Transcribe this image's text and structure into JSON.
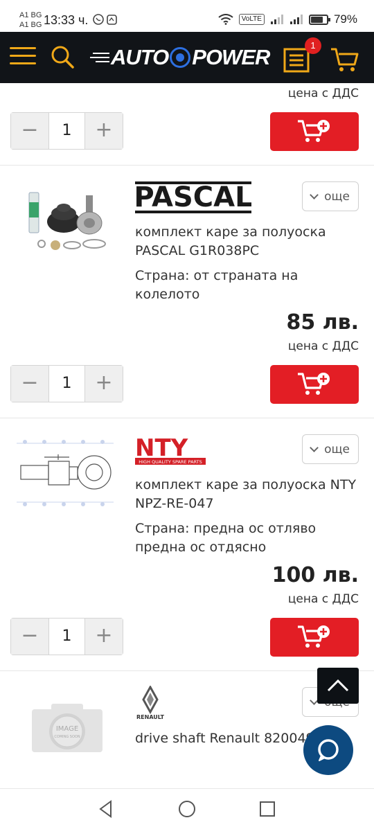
{
  "status_bar": {
    "carrier_1": "A1 BG",
    "carrier_2": "A1 BG",
    "time": "13:33 ч.",
    "volte": "VoLTE",
    "battery": "79%",
    "battery_level": 0.79
  },
  "header": {
    "logo_left": "AUTO",
    "logo_right": "POWER",
    "list_badge": "1"
  },
  "vat_label": "цена с ДДС",
  "more_label": "още",
  "products": [
    {
      "brand": "PASCAL",
      "name": "комплект каре за полуоска PASCAL G1R038PC",
      "side": "Страна: от страната на колелото",
      "price": "85 лв.",
      "qty": "1"
    },
    {
      "brand": "NTY",
      "brand_tagline": "HIGH QUALITY SPARE PARTS",
      "name": "комплект каре за полуоска NTY NPZ-RE-047",
      "side": "Страна: предна ос отляво предна ос отдясно",
      "price": "100 лв.",
      "qty": "1"
    },
    {
      "brand": "RENAULT",
      "name": "drive shaft Renault 820049",
      "image_placeholder_line1": "IMAGE",
      "image_placeholder_line2": "COMING SOON"
    }
  ],
  "previous_item": {
    "qty": "1"
  },
  "colors": {
    "topbar_bg": "#111418",
    "accent_orange": "#f0a818",
    "add_to_cart_red": "#e31e25",
    "chat_blue": "#0d4a80"
  }
}
